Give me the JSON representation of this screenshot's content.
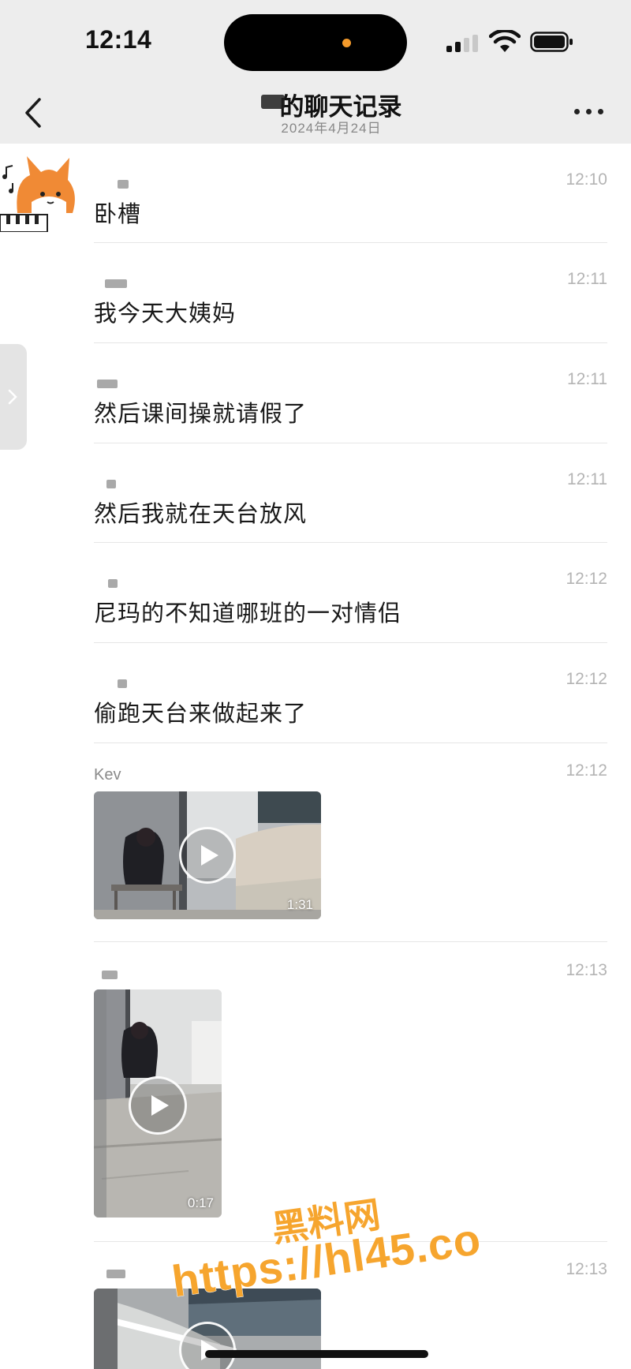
{
  "status_bar": {
    "time": "12:14"
  },
  "header": {
    "title": "的聊天记录",
    "date": "2024年4月24日",
    "back_icon": "chevron-left-icon",
    "more_icon": "more-dots-icon"
  },
  "side_handle": {
    "icon": "chevron-right-icon"
  },
  "messages": [
    {
      "sender": "",
      "time": "12:10",
      "text": "卧槽"
    },
    {
      "sender": "",
      "time": "12:11",
      "text": "我今天大姨妈"
    },
    {
      "sender": "",
      "time": "12:11",
      "text": "然后课间操就请假了"
    },
    {
      "sender": "",
      "time": "12:11",
      "text": "然后我就在天台放风"
    },
    {
      "sender": "",
      "time": "12:12",
      "text": "尼玛的不知道哪班的一对情侣"
    },
    {
      "sender": "",
      "time": "12:12",
      "text": "偷跑天台来做起来了"
    },
    {
      "sender": "Kev",
      "time": "12:12",
      "video_duration": "1:31"
    },
    {
      "sender": "",
      "time": "12:13",
      "video_duration": "0:17"
    },
    {
      "sender": "",
      "time": "12:13",
      "video_duration": ""
    }
  ],
  "watermark": {
    "line1": "黑料网",
    "line2": "https://hl45.co"
  },
  "colors": {
    "header_bg": "#ededed",
    "watermark": "#f6a52e",
    "separator": "#e6e6e6",
    "time_gray": "#b4b4b4"
  }
}
